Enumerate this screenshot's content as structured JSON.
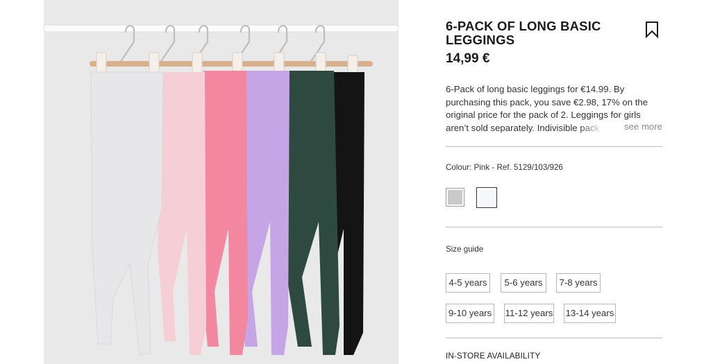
{
  "product": {
    "title": "6-PACK OF LONG BASIC LEGGINGS",
    "price": "14,99 €",
    "description": "6-Pack of long basic leggings for €14.99. By purchasing this pack, you save €2.98, 17% on the original price for the pack of 2. Leggings for girls aren’t sold separately. Indivisible pack",
    "see_more_label": "see more",
    "colour_line": "Colour: Pink - Ref. 5129/103/926",
    "size_guide_label": "Size guide",
    "sizes": [
      "4-5 years",
      "5-6 years",
      "7-8 years",
      "9-10 years",
      "11-12 years",
      "13-14 years"
    ],
    "store_availability_label": "IN-STORE AVAILABILITY"
  },
  "colors": {
    "swatch_grey": "#c7c7c7",
    "swatch_white": "#f6f7fb",
    "leggings": [
      "#e7e7ea",
      "#f6cfd6",
      "#f2879f",
      "#c6a5e6",
      "#2e4a40",
      "#141414"
    ]
  },
  "icons": {
    "bookmark": "bookmark-icon"
  }
}
